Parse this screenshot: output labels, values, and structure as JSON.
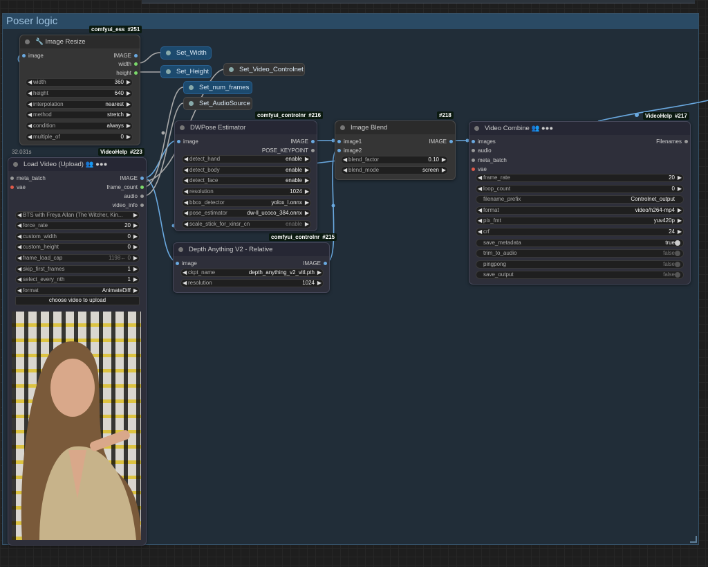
{
  "group": {
    "title": "Poser logic",
    "percent": "32.031s"
  },
  "image_resize": {
    "badge": "comfyui_ess",
    "id": "#251",
    "title": "Image Resize",
    "input": "image",
    "outputs": [
      "IMAGE",
      "width",
      "height"
    ],
    "widgets": [
      {
        "label": "width",
        "value": "360"
      },
      {
        "label": "height",
        "value": "640"
      },
      {
        "label": "interpolation",
        "value": "nearest"
      },
      {
        "label": "method",
        "value": "stretch"
      },
      {
        "label": "condition",
        "value": "always"
      },
      {
        "label": "multiple_of",
        "value": "0"
      }
    ]
  },
  "set_nodes": {
    "width": "Set_Width",
    "height": "Set_Height",
    "video_controlnet": "Set_Video_Controlnet",
    "num_frames": "Set_num_frames",
    "audio_source": "Set_AudioSource"
  },
  "load_video": {
    "badge": "VideoHelp",
    "id": "#223",
    "title": "Load Video (Upload)",
    "inputs": [
      "meta_batch",
      "vae"
    ],
    "outputs": [
      "IMAGE",
      "frame_count",
      "audio",
      "video_info"
    ],
    "widgets": [
      {
        "label": "BTS with Freya Allan (The Witcher, Kin...",
        "value": ""
      },
      {
        "label": "force_rate",
        "value": "20"
      },
      {
        "label": "custom_width",
        "value": "0"
      },
      {
        "label": "custom_height",
        "value": "0"
      },
      {
        "label": "frame_load_cap",
        "value": "1198← 0"
      },
      {
        "label": "skip_first_frames",
        "value": "1"
      },
      {
        "label": "select_every_nth",
        "value": "1"
      },
      {
        "label": "format",
        "value": "AnimateDiff"
      }
    ],
    "upload_button": "choose video to upload"
  },
  "dwpose": {
    "badge": "comfyui_controlnr",
    "id": "#216",
    "title": "DWPose Estimator",
    "input": "image",
    "outputs": [
      "IMAGE",
      "POSE_KEYPOINT"
    ],
    "widgets": [
      {
        "label": "detect_hand",
        "value": "enable"
      },
      {
        "label": "detect_body",
        "value": "enable"
      },
      {
        "label": "detect_face",
        "value": "enable"
      },
      {
        "label": "resolution",
        "value": "1024"
      },
      {
        "label": "bbox_detector",
        "value": "yolox_l.onnx"
      },
      {
        "label": "pose_estimator",
        "value": "dw-ll_ucoco_384.onnx"
      },
      {
        "label": "scale_stick_for_xinsr_cn",
        "value": "enable"
      }
    ]
  },
  "depth": {
    "badge": "comfyui_controlnr",
    "id": "#215",
    "title": "Depth Anything V2 - Relative",
    "input": "image",
    "output": "IMAGE",
    "widgets": [
      {
        "label": "ckpt_name",
        "value": "depth_anything_v2_vitl.pth"
      },
      {
        "label": "resolution",
        "value": "1024"
      }
    ]
  },
  "blend": {
    "id": "#218",
    "title": "Image Blend",
    "inputs": [
      "image1",
      "image2"
    ],
    "output": "IMAGE",
    "widgets": [
      {
        "label": "blend_factor",
        "value": "0.10"
      },
      {
        "label": "blend_mode",
        "value": "screen"
      }
    ]
  },
  "video_combine": {
    "badge": "VideoHelp",
    "id": "#217",
    "title": "Video Combine",
    "inputs": [
      "images",
      "audio",
      "meta_batch",
      "vae"
    ],
    "output": "Filenames",
    "widgets": [
      {
        "label": "frame_rate",
        "value": "20"
      },
      {
        "label": "loop_count",
        "value": "0"
      },
      {
        "label": "filename_prefix",
        "value": "Controlnet_output"
      },
      {
        "label": "format",
        "value": "video/h264-mp4"
      },
      {
        "label": "pix_fmt",
        "value": "yuv420p"
      },
      {
        "label": "crf",
        "value": "24"
      },
      {
        "label": "save_metadata",
        "value": "true"
      },
      {
        "label": "trim_to_audio",
        "value": "false"
      },
      {
        "label": "pingpong",
        "value": "false"
      },
      {
        "label": "save_output",
        "value": "false"
      }
    ]
  },
  "colors": {
    "link": "#6aa9e0",
    "link_gray": "#aaaaaa",
    "group_header": "#2a4a64"
  }
}
